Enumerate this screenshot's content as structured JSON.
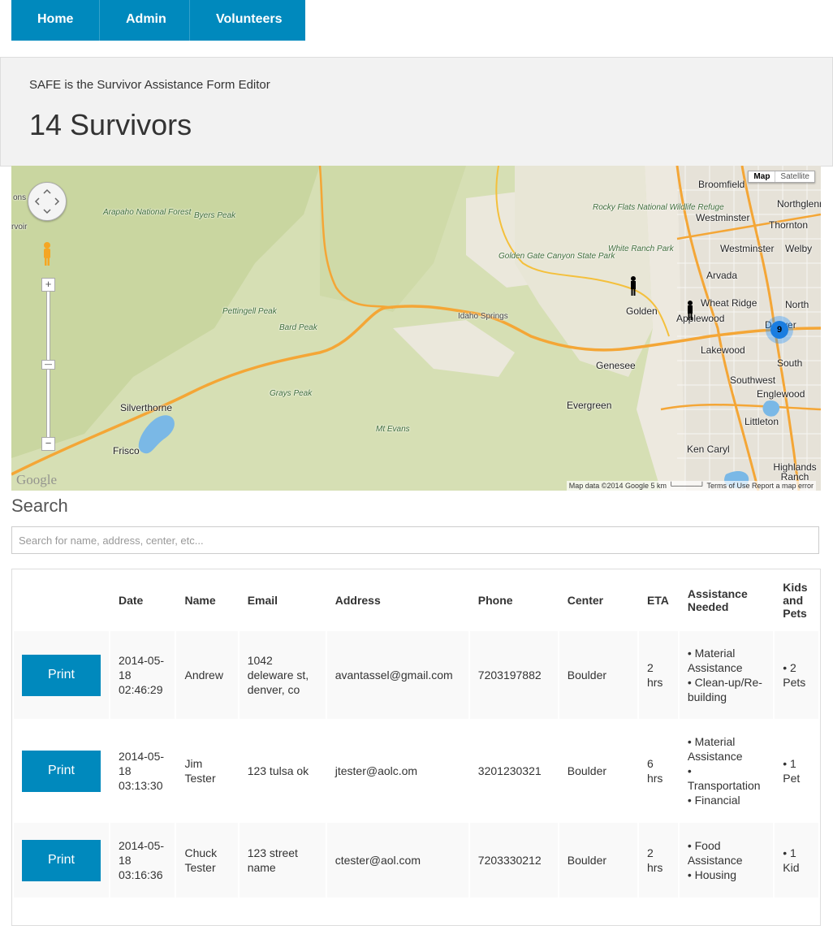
{
  "nav": {
    "items": [
      "Home",
      "Admin",
      "Volunteers"
    ]
  },
  "header": {
    "subtitle": "SAFE is the Survivor Assistance Form Editor",
    "title": "14 Survivors"
  },
  "map": {
    "type_buttons": [
      "Map",
      "Satellite"
    ],
    "labels": {
      "broomfield": "Broomfield",
      "northglenn": "Northglenn",
      "thornton": "Thornton",
      "westminster_n": "Westminster",
      "westminster": "Westminster",
      "welby": "Welby",
      "arvada": "Arvada",
      "north": "North",
      "wheat_ridge": "Wheat Ridge",
      "applewood": "Applewood",
      "denver": "Denver",
      "golden": "Golden",
      "lakewood": "Lakewood",
      "south": "South",
      "southwest": "Southwest",
      "englewood": "Englewood",
      "littleton": "Littleton",
      "ken_caryl": "Ken Caryl",
      "highlands_ranch": "Highlands Ranch",
      "genesee": "Genesee",
      "evergreen": "Evergreen",
      "idaho_springs": "Idaho Springs",
      "silverthorne": "Silverthorne",
      "frisco": "Frisco",
      "arapaho": "Arapaho National Forest",
      "byers_peak": "Byers Peak",
      "rocky_flats": "Rocky Flats National Wildlife Refuge",
      "white_ranch": "White Ranch Park",
      "golden_gate": "Golden Gate Canyon State Park",
      "pettingell": "Pettingell Peak",
      "bard_peak": "Bard Peak",
      "grays_peak": "Grays Peak",
      "mt_evans": "Mt Evans",
      "ons": "ons",
      "rvoir": "rvoir"
    },
    "cluster_count": "9",
    "google_logo": "Google",
    "attribution": "Map data ©2014 Google   5 km └─────┘   Terms of Use   Report a map error",
    "zoom_in": "+",
    "zoom_out": "−"
  },
  "search": {
    "title": "Search",
    "placeholder": "Search for name, address, center, etc..."
  },
  "table": {
    "headers": [
      "",
      "Date",
      "Name",
      "Email",
      "Address",
      "Phone",
      "Center",
      "ETA",
      "Assistance Needed",
      "Kids and Pets"
    ],
    "print_label": "Print",
    "rows": [
      {
        "date": "2014-05-18 02:46:29",
        "name": "Andrew",
        "email": "1042 deleware st, denver, co",
        "address": "avantassel@gmail.com",
        "phone": "7203197882",
        "center": "Boulder",
        "eta": "2 hrs",
        "assistance": [
          "Material Assistance",
          "Clean-up/Re-building"
        ],
        "kids_pets": [
          "2 Pets"
        ]
      },
      {
        "date": "2014-05-18 03:13:30",
        "name": "Jim Tester",
        "email": "123 tulsa ok",
        "address": "jtester@aolc.om",
        "phone": "3201230321",
        "center": "Boulder",
        "eta": "6 hrs",
        "assistance": [
          "Material Assistance",
          "Transportation",
          "Financial"
        ],
        "kids_pets": [
          "1 Pet"
        ]
      },
      {
        "date": "2014-05-18 03:16:36",
        "name": "Chuck Tester",
        "email": "123 street name",
        "address": "ctester@aol.com",
        "phone": "7203330212",
        "center": "Boulder",
        "eta": "2 hrs",
        "assistance": [
          "Food Assistance",
          "Housing"
        ],
        "kids_pets": [
          "1 Kid"
        ]
      }
    ]
  }
}
